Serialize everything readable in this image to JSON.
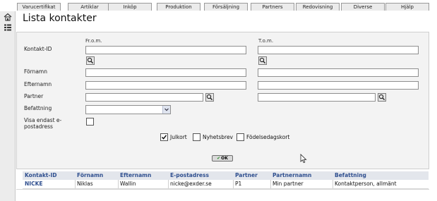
{
  "top_tabs": [
    {
      "label": "Varucertifikat"
    },
    {
      "label": "Artiklar"
    },
    {
      "label": "Inköp"
    },
    {
      "label": "Produktion"
    },
    {
      "label": "Försäljning"
    },
    {
      "label": "Partners"
    },
    {
      "label": "Redovisning"
    },
    {
      "label": "Diverse"
    },
    {
      "label": "Hjälp"
    }
  ],
  "page": {
    "title": "Lista kontakter"
  },
  "form": {
    "from_header": "Fr.o.m.",
    "to_header": "T.o.m.",
    "labels": {
      "kontakt_id": "Kontakt-ID",
      "fornamn": "Förnamn",
      "efternamn": "Efternamn",
      "partner": "Partner",
      "befattning": "Befattning",
      "visa_endast": "Visa endast e-postadress"
    },
    "checkboxes": [
      {
        "label": "Julkort",
        "checked": true
      },
      {
        "label": "Nyhetsbrev",
        "checked": false
      },
      {
        "label": "Födelsedagskort",
        "checked": false
      }
    ],
    "ok_label": "OK"
  },
  "table": {
    "headers": [
      "Kontakt-ID",
      "Förnamn",
      "Efternamn",
      "E-postadress",
      "Partner",
      "Partnernamn",
      "Befattning"
    ],
    "rows": [
      [
        "NICKE",
        "Niklas",
        "Wallin",
        "nicke@exder.se",
        "P1",
        "Min partner",
        "Kontaktperson, allmänt"
      ]
    ]
  },
  "icons": {
    "rail": [
      "home-icon",
      "list-icon"
    ],
    "lookup": "magnifier-icon"
  }
}
